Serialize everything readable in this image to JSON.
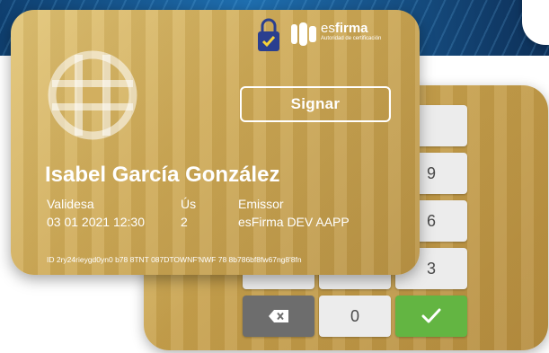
{
  "card": {
    "holder_name": "Isabel García González",
    "sign_button_label": "Signar",
    "fields": {
      "validity_label": "Validesa",
      "validity_value": "03 01 2021 12:30",
      "uses_label": "Ús",
      "uses_value": "2",
      "issuer_label": "Emissor",
      "issuer_value": "esFirma DEV AAPP"
    },
    "id_line": "ID 2ry24rieygd0yn0 b78 8TNT 087DTOWNF'NWF 78 8b786bf8fw67ng8'8fn"
  },
  "brand": {
    "name_prefix": "es",
    "name_bold": "firma",
    "subtitle": "Autoridad de certificación"
  },
  "keypad": {
    "keys_visible": [
      "9",
      "6",
      "3",
      "0"
    ],
    "backspace_icon": "backspace-icon",
    "confirm_icon": "checkmark-icon"
  },
  "colors": {
    "gold": "#cfab58",
    "confirm_green": "#63b542",
    "key_light": "#ececec",
    "key_dark": "#6d6d6d",
    "banner_blue": "#1f6fb0"
  }
}
